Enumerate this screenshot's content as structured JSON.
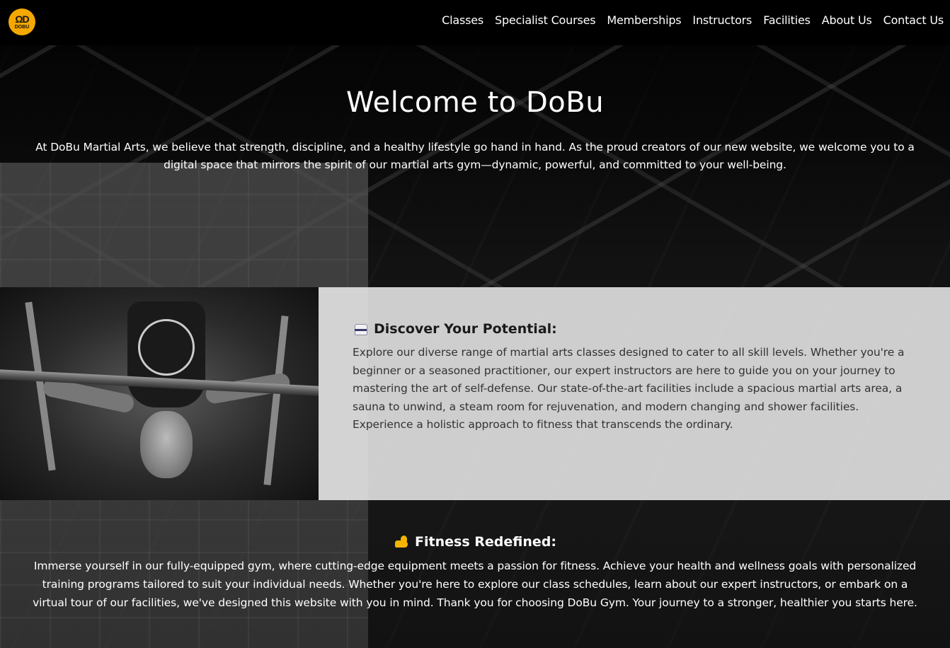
{
  "header": {
    "logo": {
      "mark": "ΩD",
      "word": "DOBU"
    },
    "nav": [
      {
        "label": "Classes"
      },
      {
        "label": "Specialist Courses"
      },
      {
        "label": "Memberships"
      },
      {
        "label": "Instructors"
      },
      {
        "label": "Facilities"
      },
      {
        "label": "About Us"
      },
      {
        "label": "Contact Us"
      }
    ]
  },
  "hero": {
    "title": "Welcome to DoBu",
    "text": "At DoBu Martial Arts, we believe that strength, discipline, and a healthy lifestyle go hand in hand. As the proud creators of our new website, we welcome you to a digital space that mirrors the spirit of our martial arts gym—dynamic, powerful, and committed to your well-being."
  },
  "discover": {
    "icon": "martial-arts-uniform-icon",
    "heading": "Discover Your Potential:",
    "text": "Explore our diverse range of martial arts classes designed to cater to all skill levels. Whether you're a beginner or a seasoned practitioner, our expert instructors are here to guide you on your journey to mastering the art of self-defense. Our state-of-the-art facilities include a spacious martial arts area, a sauna to unwind, a steam room for rejuvenation, and modern changing and shower facilities. Experience a holistic approach to fitness that transcends the ordinary."
  },
  "fitness": {
    "icon": "flexed-biceps-icon",
    "heading": "Fitness Redefined:",
    "text": "Immerse yourself in our fully-equipped gym, where cutting-edge equipment meets a passion for fitness. Achieve your health and wellness goals with personalized training programs tailored to suit your individual needs. Whether you're here to explore our class schedules, learn about our expert instructors, or embark on a virtual tour of our facilities, we've designed this website with you in mind. Thank you for choosing DoBu Gym. Your journey to a stronger, healthier you starts here."
  },
  "colors": {
    "brand": "#f5a800",
    "header_bg": "#000000",
    "panel_bg": "#e8e8e8"
  }
}
